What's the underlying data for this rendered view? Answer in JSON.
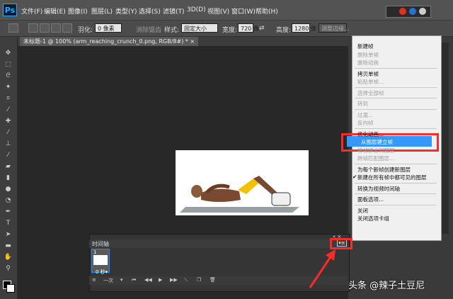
{
  "app": {
    "logo": "Ps",
    "menus": [
      "文件(F)",
      "编辑(E)",
      "图像(I)",
      "图层(L)",
      "类型(Y)",
      "选择(S)",
      "滤镜(T)",
      "3D(D)",
      "视图(V)",
      "窗口(W)",
      "帮助(H)"
    ]
  },
  "options_bar": {
    "feather_label": "羽化:",
    "feather_value": "0 像素",
    "antialias_label": "消除锯齿",
    "style_label": "样式:",
    "style_value": "固定大小",
    "width_label": "宽度:",
    "width_value": "720 像",
    "height_label": "高度:",
    "height_value": "1280 像",
    "adjust_edge_label": "调整边缘..."
  },
  "document_tab": {
    "title": "未标题-1 @ 100% (arm_reaching_crunch_0.png, RGB/8#) *",
    "close": "×"
  },
  "timeline": {
    "title": "时间轴",
    "frame_number": "1",
    "frame_delay": "0 秒▾",
    "loop_label": "一次",
    "menu_button": "▾≡",
    "collapse": "« ×"
  },
  "flyout_menu": {
    "items": [
      {
        "label": "新建帧",
        "enabled": true
      },
      {
        "label": "删除单帧",
        "enabled": false
      },
      {
        "label": "删除动画",
        "enabled": false
      },
      {
        "sep": true
      },
      {
        "label": "拷贝单帧",
        "enabled": true
      },
      {
        "label": "粘贴单帧...",
        "enabled": false
      },
      {
        "sep": true
      },
      {
        "label": "选择全部帧",
        "enabled": false
      },
      {
        "sep": true
      },
      {
        "label": "转到",
        "enabled": false
      },
      {
        "sep": true
      },
      {
        "label": "过渡...",
        "enabled": false
      },
      {
        "label": "反向帧",
        "enabled": false
      },
      {
        "sep": true
      },
      {
        "label": "优化动画...",
        "enabled": true
      },
      {
        "label": "从图层建立帧",
        "enabled": true,
        "highlighted": true
      },
      {
        "label": "将帧拼合到图层",
        "enabled": false
      },
      {
        "label": "跨帧匹配图层...",
        "enabled": false
      },
      {
        "sep": true
      },
      {
        "label": "为每个新帧创建新图层",
        "enabled": true
      },
      {
        "label": "新建在所有帧中都可见的图层",
        "enabled": true,
        "checked": true
      },
      {
        "sep": true
      },
      {
        "label": "转换为视频时间轴",
        "enabled": true
      },
      {
        "sep": true
      },
      {
        "label": "面板选项...",
        "enabled": true
      },
      {
        "sep": true
      },
      {
        "label": "关闭",
        "enabled": true
      },
      {
        "label": "关闭选项卡组",
        "enabled": true
      }
    ],
    "highlight_color": "#3399ff"
  },
  "annotations": {
    "color": "#ff2a2a"
  },
  "watermark": "头条 @辣子土豆尼"
}
